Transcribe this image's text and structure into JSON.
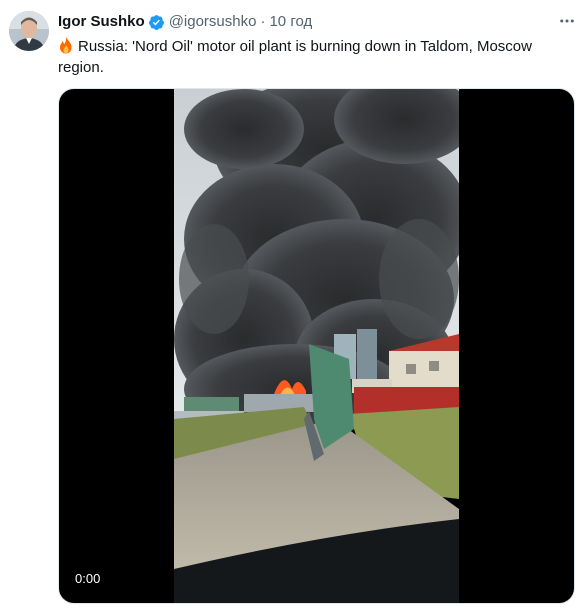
{
  "tweet": {
    "author_name": "Igor Sushko",
    "author_handle": "@igorsushko",
    "separator": "·",
    "time": "10 год",
    "text": "Russia: 'Nord Oil' motor oil plant is burning down in Taldom, Moscow region.",
    "emoji": "fire-emoji",
    "verified": true
  },
  "media": {
    "type": "video",
    "timestamp": "0:00"
  },
  "icons": {
    "verified": "verified-badge-icon",
    "more": "more-options-icon",
    "avatar": "avatar"
  },
  "colors": {
    "accent": "#1d9bf0",
    "text": "#0f1419",
    "secondary": "#536471",
    "fire": "#ff6a00"
  }
}
